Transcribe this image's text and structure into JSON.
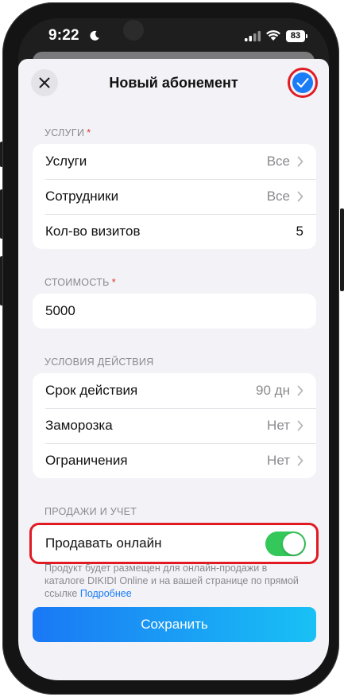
{
  "status_bar": {
    "time": "9:22",
    "battery": "83"
  },
  "nav": {
    "title": "Новый абонемент"
  },
  "sections": {
    "services": {
      "label": "УСЛУГИ",
      "required_mark": "*",
      "rows": [
        {
          "label": "Услуги",
          "value": "Все"
        },
        {
          "label": "Сотрудники",
          "value": "Все"
        },
        {
          "label": "Кол-во визитов",
          "value": "5"
        }
      ]
    },
    "price": {
      "label": "СТОИМОСТЬ",
      "required_mark": "*",
      "value": "5000"
    },
    "conditions": {
      "label": "УСЛОВИЯ ДЕЙСТВИЯ",
      "rows": [
        {
          "label": "Срок действия",
          "value": "90 дн"
        },
        {
          "label": "Заморозка",
          "value": "Нет"
        },
        {
          "label": "Ограничения",
          "value": "Нет"
        }
      ]
    },
    "sales": {
      "label": "ПРОДАЖИ И УЧЕТ",
      "toggle_label": "Продавать онлайн",
      "toggle_on": true,
      "hint": "Продукт будет размещен для онлайн-продажи в каталоге DIKIDI Online и на вашей странице по прямой ссылке",
      "hint_link": "Подробнее"
    }
  },
  "save_button": {
    "label": "Сохранить"
  },
  "colors": {
    "accent": "#1a7cf7",
    "toggle_on": "#34c759",
    "highlight": "#e01b24",
    "background": "#f2f2f7"
  }
}
